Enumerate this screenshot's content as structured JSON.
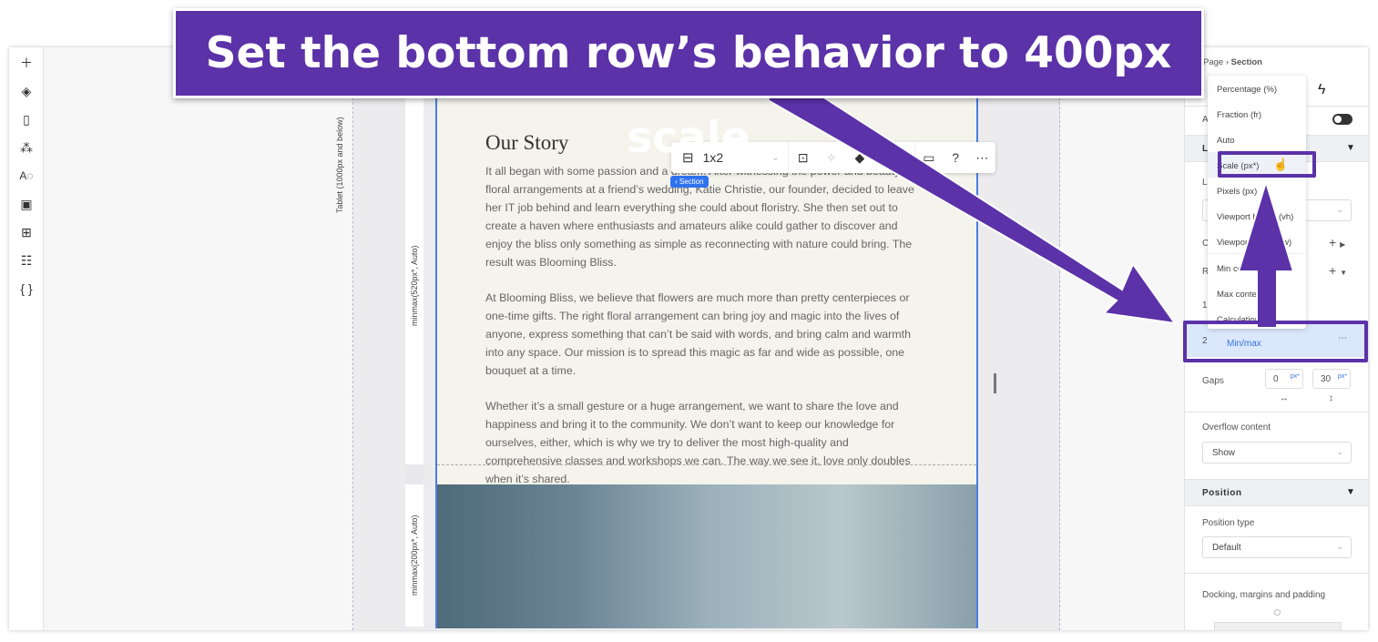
{
  "banner": {
    "instruction": "Set the bottom row’s behavior to 400px scale"
  },
  "colors": {
    "accent": "#5b32a8",
    "selection": "#4a7de0",
    "section_badge": "#2f73f0"
  },
  "left_toolbar": {
    "icons": [
      "plus-icon",
      "layers-icon",
      "page-icon",
      "components-icon",
      "typography-icon",
      "media-icon",
      "apps-icon",
      "table-icon",
      "code-icon"
    ]
  },
  "canvas": {
    "breakpoint_label": "Tablet (1000px and below)",
    "row1_label": "minmax(520px*, Auto)",
    "row2_label": "minmax(200px*, Auto)",
    "section_badge": "Section",
    "heading": "Our Story",
    "paragraphs": [
      "It all began with some passion and a dream. After witnessing the power and beauty of floral arrangements at a friend’s wedding, Katie Christie, our founder, decided to leave her IT job behind and learn everything she could about floristry. She then set out to create a haven where enthusiasts and amateurs alike could gather to discover and enjoy the bliss only something as simple as reconnecting with nature could bring. The result was Blooming Bliss.",
      "At Blooming Bliss, we believe that flowers are much more than pretty centerpieces or one-time gifts. The right floral arrangement can bring joy and magic into the lives of anyone, express something that can’t be said with words, and bring calm and warmth into any space. Our mission is to spread this magic as far and wide as possible, one bouquet at a time.",
      "Whether it’s a small gesture or a huge arrangement, we want to share the love and happiness and bring it to the community. We don’t want to keep our knowledge for ourselves, either, which is why we try to deliver the most high-quality and comprehensive classes and workshops we can. The way we see it, love only doubles when it’s shared."
    ]
  },
  "context_toolbar": {
    "layout_value": "1x2"
  },
  "panel": {
    "breadcrumb_parent": "Page",
    "breadcrumb_current": "Section",
    "frag_app": "App",
    "frag_lay": "Lay",
    "frag_lay2": "Lay",
    "frag_col": "Colu",
    "frag_row": "Row",
    "row1_index": "1",
    "row2_index": "2",
    "row2_value": "Min/max",
    "gaps_label": "Gaps",
    "gap_col": "0",
    "gap_row": "30",
    "gap_unit": "px*",
    "overflow_label": "Overflow content",
    "overflow_value": "Show",
    "position_header": "Position",
    "position_type_label": "Position type",
    "position_type_value": "Default",
    "docking_label": "Docking, margins and padding"
  },
  "dropdown": {
    "items": [
      "Percentage (%)",
      "Fraction (fr)",
      "Auto",
      "Scale (px*)",
      "Pixels (px)",
      "Viewport height (vh)",
      "Viewport width (vw)",
      "Min content",
      "Max content",
      "Calculation"
    ],
    "hovered": "Scale (px*)"
  }
}
